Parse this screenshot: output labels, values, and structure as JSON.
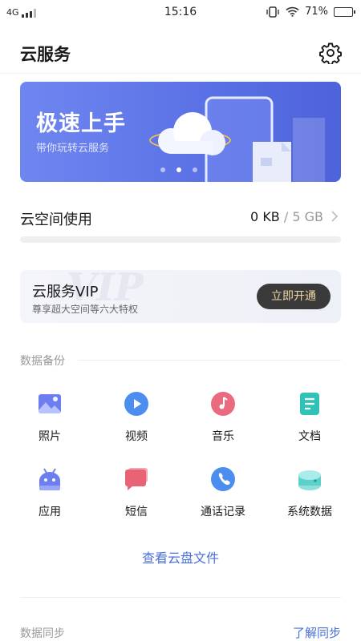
{
  "status_bar": {
    "network": "4G",
    "time": "15:16",
    "battery": "71%",
    "battery_level": 0.71
  },
  "header": {
    "title": "云服务"
  },
  "banner": {
    "title": "极速上手",
    "subtitle": "带你玩转云服务",
    "slide_count": 3,
    "active_slide": 2
  },
  "storage": {
    "label": "云空间使用",
    "used": "0 KB",
    "separator": "/",
    "total": "5 GB",
    "fraction_used": 0.0
  },
  "vip": {
    "watermark": "VIP",
    "title": "云服务VIP",
    "subtitle": "尊享超大空间等六大特权",
    "button": "立即开通"
  },
  "backup": {
    "title": "数据备份",
    "items": [
      {
        "label": "照片",
        "icon": "photo-icon"
      },
      {
        "label": "视频",
        "icon": "video-icon"
      },
      {
        "label": "音乐",
        "icon": "music-icon"
      },
      {
        "label": "文档",
        "icon": "document-icon"
      },
      {
        "label": "应用",
        "icon": "app-icon"
      },
      {
        "label": "短信",
        "icon": "sms-icon"
      },
      {
        "label": "通话记录",
        "icon": "call-log-icon"
      },
      {
        "label": "系统数据",
        "icon": "system-data-icon"
      }
    ],
    "view_files": "查看云盘文件"
  },
  "sync": {
    "title": "数据同步",
    "link": "了解同步"
  },
  "colors": {
    "accent": "#4a6fd8",
    "banner": "#5b72e6",
    "vip_button": "#3a3a3a",
    "vip_button_text": "#f0d6a4"
  }
}
